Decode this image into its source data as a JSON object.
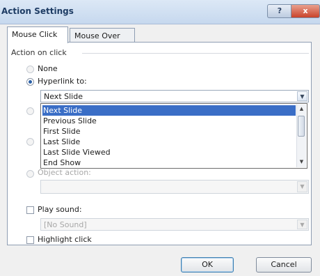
{
  "window": {
    "title": "Action Settings",
    "help_glyph": "?",
    "close_glyph": "x"
  },
  "tabs": [
    {
      "label": "Mouse Click",
      "active": true
    },
    {
      "label": "Mouse Over",
      "active": false
    }
  ],
  "action_group": {
    "label": "Action on click",
    "none_label": "None",
    "hyperlink_label": "Hyperlink to:",
    "hyperlink_value": "Next Slide",
    "object_action_label": "Object action:"
  },
  "dropdown": {
    "items": [
      "Next Slide",
      "Previous Slide",
      "First Slide",
      "Last Slide",
      "Last Slide Viewed",
      "End Show"
    ],
    "selected_index": 0
  },
  "sound": {
    "play_sound_label": "Play sound:",
    "sound_value": "[No Sound]",
    "highlight_label": "Highlight click"
  },
  "buttons": {
    "ok_label": "OK",
    "cancel_label": "Cancel"
  },
  "icons": {
    "combo_arrow": "chevron-down-icon",
    "scroll_up": "scroll-up-icon",
    "scroll_down": "scroll-down-icon"
  }
}
